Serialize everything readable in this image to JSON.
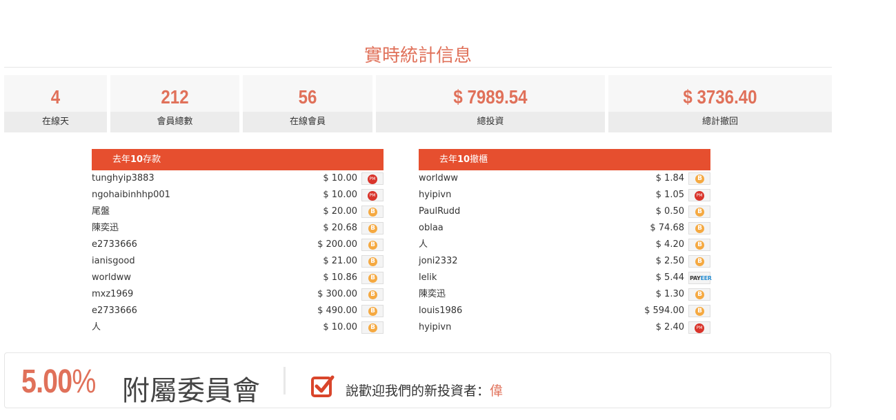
{
  "title": "實時統計信息",
  "stats": [
    {
      "value": "4",
      "label": "在線天"
    },
    {
      "value": "212",
      "label": "會員總數"
    },
    {
      "value": "56",
      "label": "在線會員"
    },
    {
      "value": "$ 7989.54",
      "label": "總投資"
    },
    {
      "value": "$ 3736.40",
      "label": "總計撤回"
    }
  ],
  "deposits": {
    "title_pre": "去年",
    "title_num": "10",
    "title_post": "存款",
    "rows": [
      {
        "name": "tunghyip3883",
        "amount": "$ 10.00",
        "method": "pm"
      },
      {
        "name": "ngohaibinhhp001",
        "amount": "$ 10.00",
        "method": "pm"
      },
      {
        "name": "尾盤",
        "amount": "$ 20.00",
        "method": "btc"
      },
      {
        "name": "陳奕迅",
        "amount": "$ 20.68",
        "method": "btc"
      },
      {
        "name": "e2733666",
        "amount": "$ 200.00",
        "method": "btc"
      },
      {
        "name": "ianisgood",
        "amount": "$ 21.00",
        "method": "btc"
      },
      {
        "name": "worldww",
        "amount": "$ 10.86",
        "method": "btc"
      },
      {
        "name": "mxz1969",
        "amount": "$ 300.00",
        "method": "btc"
      },
      {
        "name": "e2733666",
        "amount": "$ 490.00",
        "method": "btc"
      },
      {
        "name": "人",
        "amount": "$ 10.00",
        "method": "btc"
      }
    ]
  },
  "withdrawals": {
    "title_pre": "去年",
    "title_num": "10",
    "title_post": "撤櫃",
    "rows": [
      {
        "name": "worldww",
        "amount": "$ 1.84",
        "method": "btc"
      },
      {
        "name": "hyipivn",
        "amount": "$ 1.05",
        "method": "pm"
      },
      {
        "name": "PaulRudd",
        "amount": "$ 0.50",
        "method": "btc"
      },
      {
        "name": "oblaa",
        "amount": "$ 74.68",
        "method": "btc"
      },
      {
        "name": "人",
        "amount": "$ 4.20",
        "method": "btc"
      },
      {
        "name": "joni2332",
        "amount": "$ 2.50",
        "method": "btc"
      },
      {
        "name": "lelik",
        "amount": "$ 5.44",
        "method": "payeer"
      },
      {
        "name": "陳奕迅",
        "amount": "$ 1.30",
        "method": "btc"
      },
      {
        "name": "louis1986",
        "amount": "$ 594.00",
        "method": "btc"
      },
      {
        "name": "hyipivn",
        "amount": "$ 2.40",
        "method": "pm"
      }
    ]
  },
  "icons": {
    "btc": "B",
    "pm": "PM",
    "payeer_a": "PAY",
    "payeer_b": "EER"
  },
  "affiliate": {
    "percent": "5.00",
    "percent_sign": "%",
    "label": "附屬委員會",
    "welcome": "說歡迎我們的新投資者：",
    "newest": "偉"
  },
  "colors": {
    "accent": "#e0715a",
    "header_bar": "#e64f2f",
    "btc": "#f5a941",
    "pm": "#d9342b"
  }
}
